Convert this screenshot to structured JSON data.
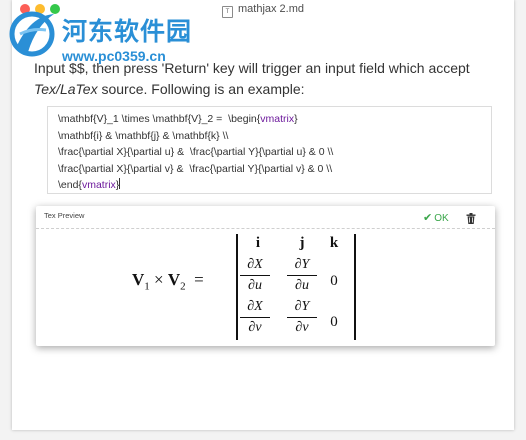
{
  "window": {
    "title": "mathjax 2.md",
    "doc_icon_glyph": "T"
  },
  "watermark": {
    "name": "河东软件园",
    "url": "www.pc0359.cn"
  },
  "intro": {
    "line1_prefix": "Input $$, then press 'Return' key will trigger an input field which accept",
    "italic": "Tex/LaTex",
    "line2_suffix": " source. Following is an example:"
  },
  "code": {
    "line1_a": "\\mathbf{V}_1 \\times \\mathbf{V}_2 =  \\begin{",
    "line1_tok": "vmatrix",
    "line1_b": "}",
    "line2": "\\mathbf{i} & \\mathbf{j} & \\mathbf{k} \\\\",
    "line3": "\\frac{\\partial X}{\\partial u} &  \\frac{\\partial Y}{\\partial u} & 0 \\\\",
    "line4": "\\frac{\\partial X}{\\partial v} &  \\frac{\\partial Y}{\\partial v} & 0 \\\\",
    "line5_a": "\\end{",
    "line5_tok": "vmatrix",
    "line5_b": "}"
  },
  "preview": {
    "title": "Tex Preview",
    "ok_label": "OK",
    "check_glyph": "✔",
    "icons": {
      "ok": "check-icon",
      "delete": "trash-icon"
    },
    "colors": {
      "ok": "#3aa64a"
    }
  },
  "math": {
    "v": "V",
    "sub1": "1",
    "sub2": "2",
    "times": "×",
    "eq": "=",
    "i": "i",
    "j": "j",
    "k": "k",
    "dX": "∂X",
    "dY": "∂Y",
    "du": "∂u",
    "dv": "∂v",
    "zero": "0"
  }
}
